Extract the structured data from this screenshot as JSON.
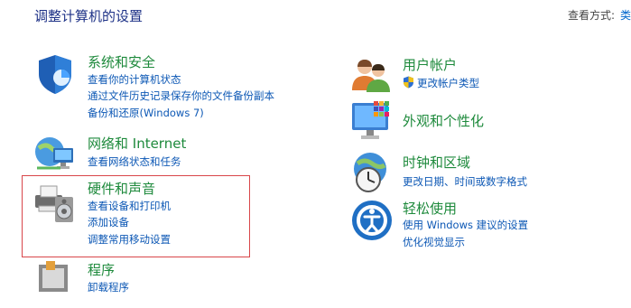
{
  "header": {
    "title": "调整计算机的设置",
    "view_by_label": "查看方式:",
    "view_by_value": "类"
  },
  "left": [
    {
      "title": "系统和安全",
      "links": [
        "查看你的计算机状态",
        "通过文件历史记录保存你的文件备份副本",
        "备份和还原(Windows 7)"
      ],
      "icon": "shield-icon"
    },
    {
      "title": "网络和 Internet",
      "links": [
        "查看网络状态和任务"
      ],
      "icon": "network-globe-icon"
    },
    {
      "title": "硬件和声音",
      "links": [
        "查看设备和打印机",
        "添加设备",
        "调整常用移动设置"
      ],
      "icon": "printer-speaker-icon"
    },
    {
      "title": "程序",
      "links": [
        "卸载程序"
      ],
      "icon": "programs-icon"
    }
  ],
  "right": [
    {
      "title": "用户帐户",
      "links": [
        "更改帐户类型"
      ],
      "icon": "users-icon"
    },
    {
      "title": "外观和个性化",
      "links": [],
      "icon": "monitor-palette-icon"
    },
    {
      "title": "时钟和区域",
      "links": [
        "更改日期、时间或数字格式"
      ],
      "icon": "clock-globe-icon"
    },
    {
      "title": "轻松使用",
      "links": [
        "使用 Windows 建议的设置",
        "优化视觉显示"
      ],
      "icon": "ease-of-access-icon"
    }
  ],
  "colors": {
    "category_title": "#1e8a3c",
    "link": "#0d58b5",
    "header": "#1e3287",
    "highlight_border": "#d9464a"
  }
}
